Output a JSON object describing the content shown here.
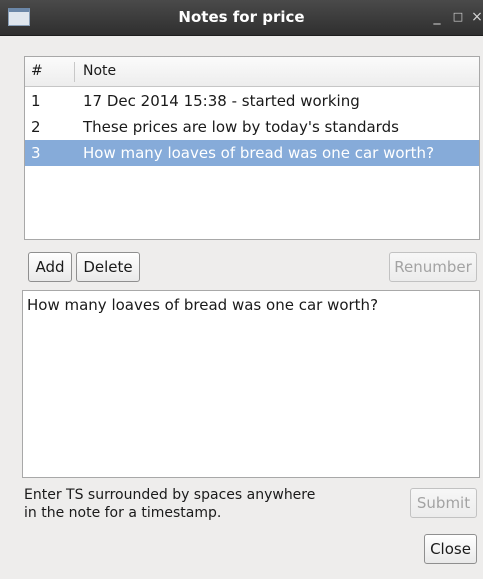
{
  "window": {
    "title": "Notes for price",
    "minimize_glyph": "_",
    "maximize_glyph": "□",
    "close_glyph": "×"
  },
  "table": {
    "columns": [
      "#",
      "Note"
    ],
    "rows": [
      {
        "num": "1",
        "note": "17 Dec 2014 15:38 - started working"
      },
      {
        "num": "2",
        "note": "These prices are low by today's standards"
      },
      {
        "num": "3",
        "note": "How many loaves of bread was one car worth?"
      }
    ],
    "selected_row": 3
  },
  "buttons": {
    "add": "Add",
    "delete": "Delete",
    "renumber": "Renumber",
    "submit": "Submit",
    "close": "Close"
  },
  "editor": {
    "value": "How many loaves of bread was one car worth?"
  },
  "hint": {
    "line1": "Enter TS surrounded by spaces anywhere",
    "line2": "in the note for a timestamp."
  },
  "colors": {
    "selection": "#86abd9",
    "titlebar": "#2f2f2f"
  }
}
